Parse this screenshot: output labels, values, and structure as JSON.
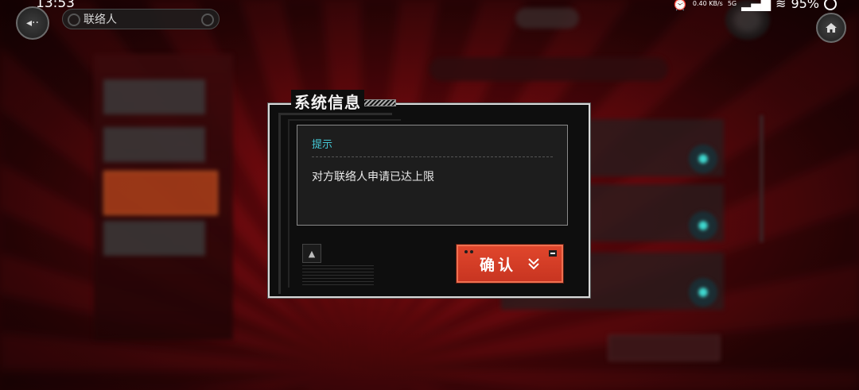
{
  "status_bar": {
    "time": "13:53",
    "network_speed": "0.40 KB/s",
    "signal": "5G",
    "battery": "95%"
  },
  "header": {
    "title": "联络人"
  },
  "dialog": {
    "title": "系统信息",
    "hint_label": "提示",
    "message": "对方联络人申请已达上限",
    "confirm_label": "确认"
  },
  "icons": {
    "back": "back-arrow-icon",
    "home": "home-icon",
    "confirm_arrow": "double-chevron-down-icon"
  },
  "colors": {
    "accent": "#d8402a",
    "hint_text": "#45c8d6",
    "background": "#7a0b10"
  }
}
